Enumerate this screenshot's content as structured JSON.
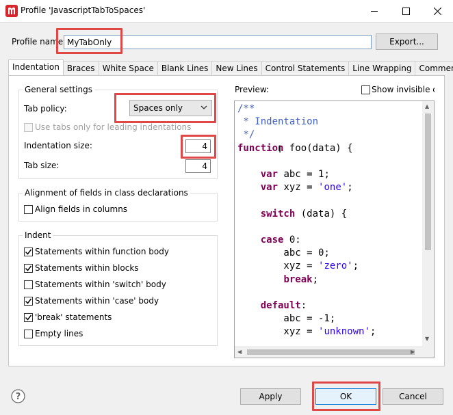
{
  "window": {
    "title": "Profile 'JavascriptTabToSpaces'"
  },
  "profile": {
    "name_label": "Profile name:",
    "name_value": "MyTabOnly",
    "export_label": "Export..."
  },
  "tabs": [
    {
      "label": "Indentation",
      "active": true
    },
    {
      "label": "Braces"
    },
    {
      "label": "White Space"
    },
    {
      "label": "Blank Lines"
    },
    {
      "label": "New Lines"
    },
    {
      "label": "Control Statements"
    },
    {
      "label": "Line Wrapping"
    },
    {
      "label": "Comments"
    }
  ],
  "general": {
    "title": "General settings",
    "tab_policy_label": "Tab policy:",
    "tab_policy_value": "Spaces only",
    "use_tabs_label": "Use tabs only for leading indentations",
    "indentation_size_label": "Indentation size:",
    "indentation_size_value": "4",
    "tab_size_label": "Tab size:",
    "tab_size_value": "4"
  },
  "alignment": {
    "title": "Alignment of fields in class declarations",
    "align_fields_label": "Align fields in columns"
  },
  "indent": {
    "title": "Indent",
    "items": [
      {
        "label": "Statements within function body",
        "checked": true
      },
      {
        "label": "Statements within blocks",
        "checked": true
      },
      {
        "label": "Statements within 'switch' body",
        "checked": false
      },
      {
        "label": "Statements within 'case' body",
        "checked": true
      },
      {
        "label": "'break' statements",
        "checked": true
      },
      {
        "label": "Empty lines",
        "checked": false
      }
    ]
  },
  "preview": {
    "label": "Preview:",
    "show_invisible_label": "Show invisible ch",
    "code": [
      "/**",
      " * Indentation",
      " */",
      "function foo(data) {",
      "",
      "    var abc = 1;",
      "    var xyz = 'one';",
      "",
      "    switch (data) {",
      "",
      "    case 0:",
      "        abc = 0;",
      "        xyz = 'zero';",
      "        break;",
      "",
      "    default:",
      "        abc = -1;",
      "        xyz = 'unknown';"
    ]
  },
  "footer": {
    "help_icon": "help-icon",
    "apply_label": "Apply",
    "ok_label": "OK",
    "cancel_label": "Cancel"
  },
  "colors": {
    "highlight": "#e04848",
    "keyword": "#7f0055",
    "comment": "#3f5fbf",
    "string": "#2a00ff"
  }
}
